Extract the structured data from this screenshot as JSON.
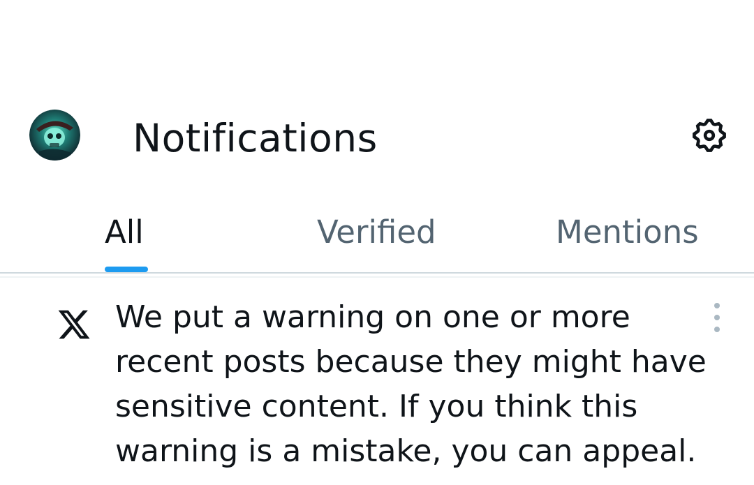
{
  "header": {
    "title": "Notifications",
    "avatar_icon": "skull-avatar",
    "settings_icon": "gear-icon"
  },
  "tabs": [
    {
      "label": "All",
      "active": true
    },
    {
      "label": "Verified",
      "active": false
    },
    {
      "label": "Mentions",
      "active": false
    }
  ],
  "notification": {
    "icon": "x-logo-icon",
    "text": "We put a warning on one or more recent posts because they might have sensitive content. If you think this warning is a mistake, you can appeal.",
    "menu_icon": "more-vertical-icon"
  },
  "colors": {
    "accent": "#1d9bf0",
    "text_primary": "#0f1419",
    "text_secondary": "#536471"
  }
}
